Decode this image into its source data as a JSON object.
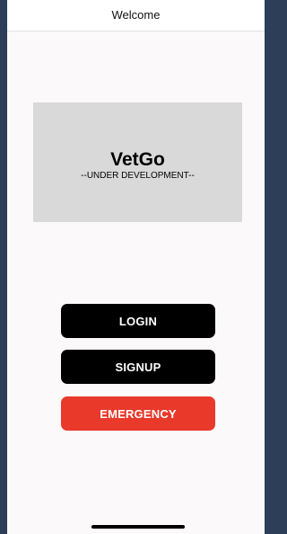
{
  "header": {
    "title": "Welcome"
  },
  "banner": {
    "app_name": "VetGo",
    "status": "--UNDER DEVELOPMENT--"
  },
  "actions": {
    "login_label": "LOGIN",
    "signup_label": "SIGNUP",
    "emergency_label": "EMERGENCY"
  },
  "colors": {
    "primary_button": "#000000",
    "emergency_button": "#e8392b",
    "banner_background": "#d9d9d9",
    "screen_background": "#fbf9f9"
  }
}
